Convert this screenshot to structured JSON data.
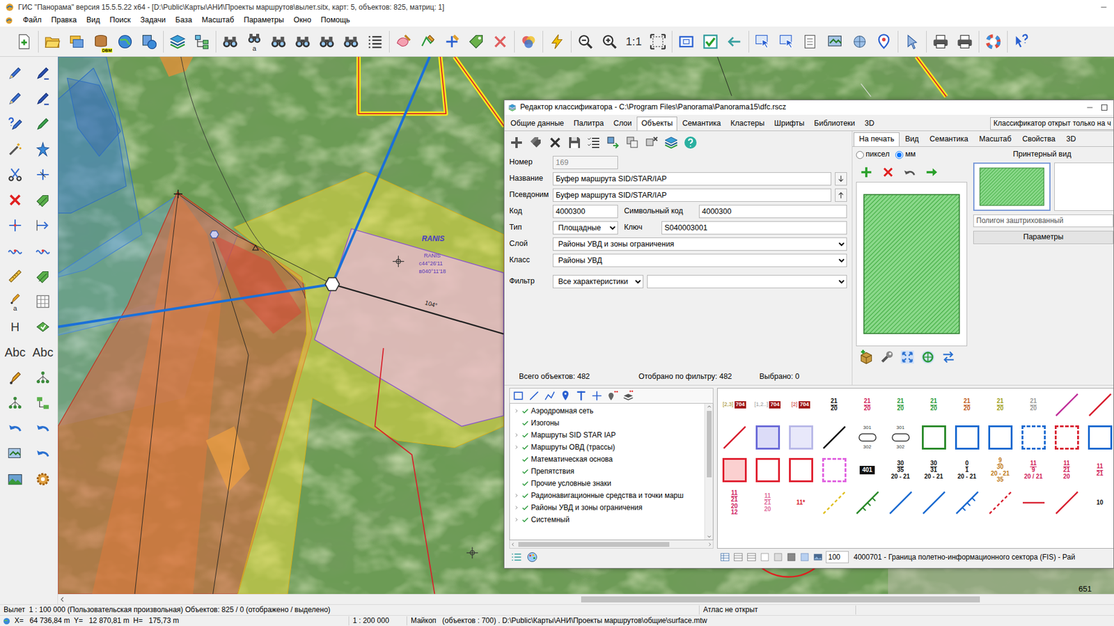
{
  "window": {
    "title": "ГИС \"Панорама\" версия 15.5.5.22 x64 - [D:\\Public\\Карты\\АНИ\\Проекты маршрутов\\вылет.sitx, карт: 5, объектов: 825, матриц: 1]"
  },
  "menu": [
    "Файл",
    "Правка",
    "Вид",
    "Поиск",
    "Задачи",
    "База",
    "Масштаб",
    "Параметры",
    "Окно",
    "Помощь"
  ],
  "toolbar": {
    "db_badge": "DBM",
    "binoc_sub": "a",
    "scale": "1:1"
  },
  "left_toolbar": {
    "pen_sub": "a",
    "height": "H",
    "text_a": "Abc",
    "text_b": "Abc"
  },
  "map": {
    "labels": [
      {
        "text": "RANIS",
        "kind": "name"
      },
      {
        "text": "RANIS",
        "kind": "tag"
      },
      {
        "text": "с44°26'11",
        "kind": "tag"
      },
      {
        "text": "в040°11'18",
        "kind": "tag"
      },
      {
        "text": "104°",
        "kind": "angle"
      },
      {
        "text": "651",
        "kind": "number"
      }
    ]
  },
  "classifier": {
    "title": "Редактор классификатора - C:\\Program Files\\Panorama\\Panorama15\\dfc.rscz",
    "tabs": [
      {
        "label": "Общие данные",
        "selected": false
      },
      {
        "label": "Палитра",
        "selected": false
      },
      {
        "label": "Слои",
        "selected": false
      },
      {
        "label": "Объекты",
        "selected": true
      },
      {
        "label": "Семантика",
        "selected": false
      },
      {
        "label": "Кластеры",
        "selected": false
      },
      {
        "label": "Шрифты",
        "selected": false
      },
      {
        "label": "Библиотеки",
        "selected": false
      },
      {
        "label": "3D",
        "selected": false
      }
    ],
    "readonly_note": "Классификатор открыт только на ч",
    "form": {
      "rows": [
        [
          {
            "label": "Номер",
            "value": "169",
            "kind": "input",
            "disabled": true
          }
        ],
        [
          {
            "label": "Название",
            "value": "Буфер маршрута SID/STAR/IAP",
            "kind": "input",
            "disabled": false
          }
        ],
        [
          {
            "label": "Псевдоним",
            "value": "Буфер маршрута SID/STAR/IAP",
            "kind": "input",
            "disabled": false
          }
        ],
        [
          {
            "label": "Код",
            "value": "4000300",
            "kind": "input",
            "disabled": false
          },
          {
            "label": "Символьный код",
            "value": "4000300",
            "kind": "input",
            "disabled": false
          }
        ],
        [
          {
            "label": "Тип",
            "value": "Площадные",
            "kind": "select",
            "disabled": false
          },
          {
            "label": "Ключ",
            "value": "S040003001",
            "kind": "input",
            "disabled": false
          }
        ],
        [
          {
            "label": "Слой",
            "value": "Районы УВД и зоны ограничения",
            "kind": "select",
            "disabled": false
          }
        ],
        [
          {
            "label": "Класс",
            "value": "Районы УВД",
            "kind": "select",
            "disabled": false
          }
        ]
      ],
      "filter": {
        "label": "Фильтр",
        "value": "Все характеристики",
        "extra": ""
      }
    },
    "counts": [
      "Всего объектов: 482",
      "Отобрано по фильтру: 482",
      "Выбрано: 0"
    ],
    "view_tabs": [
      {
        "label": "На печать",
        "selected": true
      },
      {
        "label": "Вид",
        "selected": false
      },
      {
        "label": "Семантика",
        "selected": false
      },
      {
        "label": "Масштаб",
        "selected": false
      },
      {
        "label": "Свойства",
        "selected": false
      },
      {
        "label": "3D",
        "selected": false
      }
    ],
    "units": [
      {
        "label": "пиксел",
        "selected": false
      },
      {
        "label": "мм",
        "selected": true
      }
    ],
    "printer_view": "Принтерный вид",
    "thumbnail": "Полигон заштрихованный",
    "params": "Параметры",
    "tree": [
      {
        "label": "Аэродромная сеть",
        "expandable": true,
        "checked": true
      },
      {
        "label": "Изогоны",
        "expandable": false,
        "checked": true
      },
      {
        "label": "Маршруты SID STAR IAP",
        "expandable": true,
        "checked": true
      },
      {
        "label": "Маршруты ОВД (трассы)",
        "expandable": true,
        "checked": true
      },
      {
        "label": "Математическая основа",
        "expandable": false,
        "checked": true
      },
      {
        "label": "Препятствия",
        "expandable": false,
        "checked": true
      },
      {
        "label": "Прочие условные знаки",
        "expandable": false,
        "checked": true
      },
      {
        "label": "Радионавигационные средства и точки марш",
        "expandable": true,
        "checked": true
      },
      {
        "label": "Районы УВД и зоны ограничения",
        "expandable": true,
        "checked": true
      },
      {
        "label": "Системный",
        "expandable": true,
        "checked": true
      }
    ],
    "symbols": [
      {
        "kind": "tag",
        "texts": [
          "[2,3]",
          "704"
        ],
        "color": "#a08a20"
      },
      {
        "kind": "tag",
        "texts": [
          "[1,2..]",
          "704"
        ],
        "color": "#9a9a9a"
      },
      {
        "kind": "tag",
        "texts": [
          "[2]",
          "704"
        ],
        "color": "#c82828"
      },
      {
        "kind": "label",
        "texts": [
          "21",
          "20"
        ],
        "color": "#111111"
      },
      {
        "kind": "label",
        "texts": [
          "21",
          "20"
        ],
        "color": "#d0205a"
      },
      {
        "kind": "label",
        "texts": [
          "21",
          "20"
        ],
        "color": "#2a9a3a"
      },
      {
        "kind": "label",
        "texts": [
          "21",
          "20"
        ],
        "color": "#2a9a3a"
      },
      {
        "kind": "label",
        "texts": [
          "21",
          "20"
        ],
        "color": "#c05a20"
      },
      {
        "kind": "label",
        "texts": [
          "21",
          "20"
        ],
        "color": "#a0a020"
      },
      {
        "kind": "label",
        "texts": [
          "21",
          "20"
        ],
        "color": "#9a9a9a"
      },
      {
        "kind": "line",
        "texts": [],
        "color": "#c0309a"
      },
      {
        "kind": "line",
        "texts": [],
        "color": "#d82030"
      },
      {
        "kind": "line",
        "texts": [],
        "color": "#d82030"
      },
      {
        "kind": "box",
        "texts": [],
        "color": "#6a6ad8",
        "fill": "#dcdcf8"
      },
      {
        "kind": "box",
        "texts": [],
        "color": "#b8b8e8",
        "fill": "#e8e8fa"
      },
      {
        "kind": "line",
        "texts": [],
        "color": "#111111"
      },
      {
        "kind": "loop",
        "texts": [
          "301",
          "302"
        ],
        "color": "#333333"
      },
      {
        "kind": "loop",
        "texts": [
          "301",
          "302"
        ],
        "color": "#333333"
      },
      {
        "kind": "box",
        "texts": [],
        "color": "#2a8a2a",
        "fill": "#ffffff"
      },
      {
        "kind": "box",
        "texts": [],
        "color": "#1a6ad0",
        "fill": "#ffffff"
      },
      {
        "kind": "box",
        "texts": [],
        "color": "#1a6ad0",
        "fill": "#ffffff"
      },
      {
        "kind": "dbox",
        "texts": [],
        "color": "#1a6ad0",
        "fill": "#ffffff"
      },
      {
        "kind": "dbox",
        "texts": [],
        "color": "#d82030",
        "fill": "#ffffff"
      },
      {
        "kind": "box",
        "texts": [],
        "color": "#1a6ad0",
        "fill": "#ffffff"
      },
      {
        "kind": "box",
        "texts": [],
        "color": "#e02030",
        "fill": "#fbd0d0"
      },
      {
        "kind": "box",
        "texts": [],
        "color": "#e02030",
        "fill": "#ffffff"
      },
      {
        "kind": "box",
        "texts": [],
        "color": "#e02030",
        "fill": "#ffffff"
      },
      {
        "kind": "dbox",
        "texts": [],
        "color": "#e060e0",
        "fill": "#ffffff"
      },
      {
        "kind": "num",
        "texts": [
          "401"
        ],
        "color": "#111111"
      },
      {
        "kind": "label",
        "texts": [
          "30",
          "35",
          "20 - 21"
        ],
        "color": "#111111"
      },
      {
        "kind": "label",
        "texts": [
          "30",
          "31",
          "20 - 21"
        ],
        "color": "#111111"
      },
      {
        "kind": "label",
        "texts": [
          "0",
          "1",
          "20 - 21"
        ],
        "color": "#111111"
      },
      {
        "kind": "label",
        "texts": [
          "9",
          "30",
          "20 - 21",
          "35"
        ],
        "color": "#c07a20"
      },
      {
        "kind": "label",
        "texts": [
          "11",
          "9",
          "20 / 21"
        ],
        "color": "#d0205a"
      },
      {
        "kind": "label",
        "texts": [
          "11",
          "21",
          "20"
        ],
        "color": "#d0205a"
      },
      {
        "kind": "label",
        "texts": [
          "11",
          "21"
        ],
        "color": "#d0205a"
      },
      {
        "kind": "label",
        "texts": [
          "11",
          "21",
          "20",
          "12"
        ],
        "color": "#d02060"
      },
      {
        "kind": "label",
        "texts": [
          "11",
          "21",
          "20"
        ],
        "color": "#e070a0"
      },
      {
        "kind": "label",
        "texts": [
          "11*"
        ],
        "color": "#d82030"
      },
      {
        "kind": "dash",
        "texts": [],
        "color": "#e0c020"
      },
      {
        "kind": "tick",
        "texts": [],
        "color": "#2a8a2a"
      },
      {
        "kind": "line",
        "texts": [],
        "color": "#1a6ad0"
      },
      {
        "kind": "line",
        "texts": [],
        "color": "#1a6ad0"
      },
      {
        "kind": "tick",
        "texts": [],
        "color": "#1a6ad0"
      },
      {
        "kind": "dash",
        "texts": [],
        "color": "#d82030"
      },
      {
        "kind": "hline",
        "texts": [],
        "color": "#d82030"
      },
      {
        "kind": "line",
        "texts": [],
        "color": "#d82030"
      },
      {
        "kind": "label",
        "texts": [
          "10"
        ],
        "color": "#111111"
      }
    ],
    "zoom": "100",
    "current_symbol": "4000701 - Граница полетно-информационного сектора (FIS) - Рай"
  },
  "status_bar": {
    "map_info": "Вылет  1 : 100 000 (Пользовательская произвольная) Объектов: 825 / 0 (отображено / выделено)",
    "atlas": "Атлас не открыт",
    "coords": "X=   64 736,84 m  Y=   12 870,81 m  H=   175,73 m",
    "scale": "1 : 200 000",
    "matrix": "Майкоп   (объектов : 700) . D:\\Public\\Карты\\АНИ\\Проекты маршрутов\\общие\\surface.mtw"
  }
}
